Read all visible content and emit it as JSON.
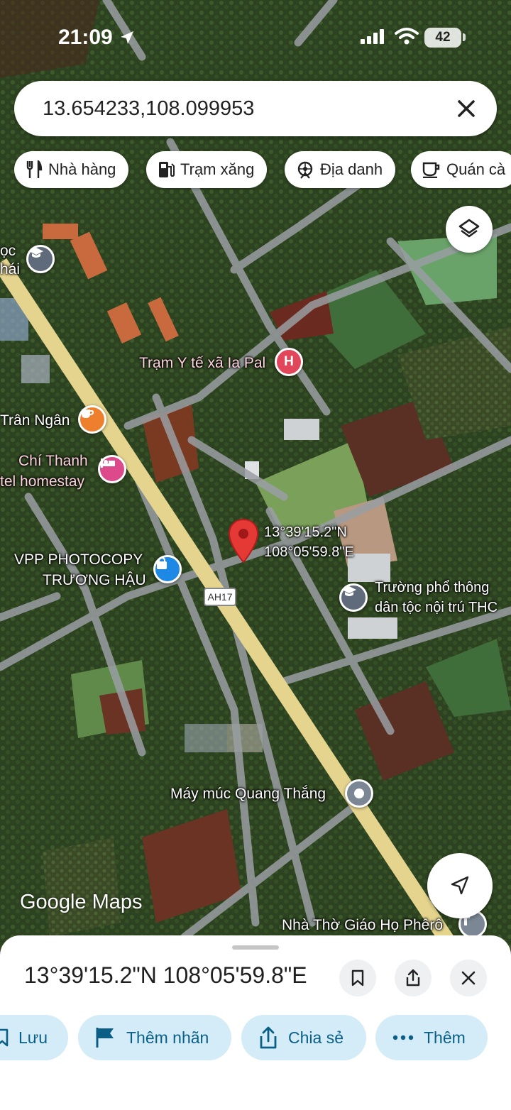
{
  "status_bar": {
    "time": "21:09",
    "battery": "42"
  },
  "search": {
    "query": "13.654233,108.099953"
  },
  "chips": [
    {
      "label": "Nhà hàng",
      "icon": "fork-knife-icon"
    },
    {
      "label": "Trạm xăng",
      "icon": "gas-station-icon"
    },
    {
      "label": "Địa danh",
      "icon": "landmark-icon"
    },
    {
      "label": "Quán cà",
      "icon": "coffee-icon"
    }
  ],
  "map": {
    "labels": {
      "school_left_line1": "ọc",
      "school_left_line2": "hái",
      "health_station": "Trạm Y tế xã Ia Pal",
      "cafe": "Trân Ngân",
      "homestay_line1": "Chí Thanh",
      "homestay_line2": "tel homestay",
      "photocopy_line1": "VPP PHOTOCOPY",
      "photocopy_line2": "TRƯƠNG HẬU",
      "road_shield": "AH17",
      "pin_coord_line1": "13°39'15.2\"N",
      "pin_coord_line2": "108°05'59.8\"E",
      "boarding_school_line1": "Trường phổ thông",
      "boarding_school_line2": "dân tộc nội trú THC",
      "excavator": "Máy múc Quang Thắng",
      "church": "Nhà Thờ Giáo Họ Phêrô"
    },
    "attribution": "Google Maps",
    "pin_color": "#e53935"
  },
  "sheet": {
    "title": "13°39'15.2\"N 108°05'59.8\"E",
    "actions": [
      {
        "label": "Lưu",
        "icon": "bookmark-icon"
      },
      {
        "label": "Thêm nhãn",
        "icon": "flag-icon"
      },
      {
        "label": "Chia sẻ",
        "icon": "share-icon"
      },
      {
        "label": "Thêm",
        "icon": "more-dots-icon"
      }
    ]
  },
  "colors": {
    "accent_chip_bg": "#d3ecf8",
    "accent_chip_text": "#0b5f86"
  }
}
